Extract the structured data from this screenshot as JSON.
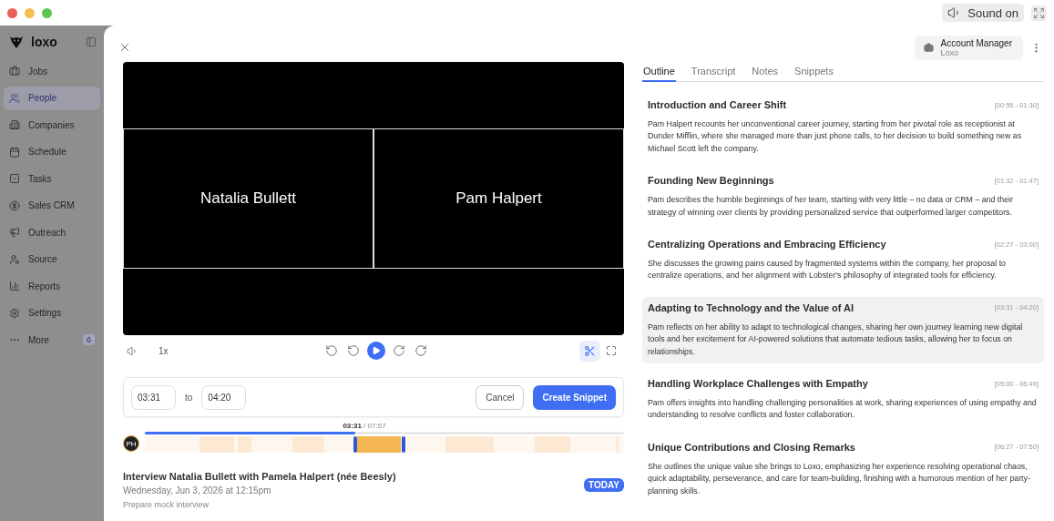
{
  "window": {
    "sound_button": "Sound on"
  },
  "sidebar": {
    "logo": "loxo",
    "items": [
      {
        "label": "Jobs",
        "selected": false
      },
      {
        "label": "People",
        "selected": true
      },
      {
        "label": "Companies",
        "selected": false
      },
      {
        "label": "Schedule",
        "selected": false
      },
      {
        "label": "Tasks",
        "selected": false
      },
      {
        "label": "Sales CRM",
        "selected": false
      },
      {
        "label": "Outreach",
        "selected": false
      },
      {
        "label": "Source",
        "selected": false
      },
      {
        "label": "Reports",
        "selected": false
      },
      {
        "label": "Settings",
        "selected": false
      },
      {
        "label": "More",
        "selected": false,
        "badge": "6"
      }
    ]
  },
  "account": {
    "title": "Account Manager",
    "subtitle": "Loxo"
  },
  "video": {
    "participants": [
      "Natalia Bullett",
      "Pam Halpert"
    ]
  },
  "player": {
    "speed": "1x",
    "clip_mode": true
  },
  "snippet": {
    "start": "03:31",
    "separator": "to",
    "end": "04:20",
    "cancel": "Cancel",
    "create": "Create Snippet"
  },
  "timeline": {
    "current": "03:31",
    "total": "/ 07:57",
    "level": 0.44,
    "avatar": "PH"
  },
  "meeting": {
    "title": "Interview Natalia Bullett with Pamela Halpert (née Beesly)",
    "date": "Wednesday, Jun 3, 2026 at 12:15pm",
    "badge": "TODAY",
    "note": "Prepare mock interview"
  },
  "tabs": [
    {
      "label": "Outline",
      "selected": true
    },
    {
      "label": "Transcript",
      "selected": false
    },
    {
      "label": "Notes",
      "selected": false
    },
    {
      "label": "Snippets",
      "selected": false
    }
  ],
  "outline": [
    {
      "title": "Introduction and Career Shift",
      "time": "[00:55 - 01:30]",
      "summary": "Pam Halpert recounts her unconventional career journey, starting from her pivotal role as receptionist at Dunder Mifflin, where she managed more than just phone calls, to her decision to build something new as Michael Scott left the company.",
      "selected": false
    },
    {
      "title": "Founding New Beginnings",
      "time": "[01:32 - 01:47]",
      "summary": "Pam describes the humble beginnings of her team, starting with very little – no data or CRM – and their strategy of winning over clients by providing personalized service that outperformed larger competitors.",
      "selected": false
    },
    {
      "title": "Centralizing Operations and Embracing Efficiency",
      "time": "[02:27 - 03:00]",
      "summary": "She discusses the growing pains caused by fragmented systems within the company, her proposal to centralize operations, and her alignment with Lobster's philosophy of integrated tools for efficiency.",
      "selected": false
    },
    {
      "title": "Adapting to Technology and the Value of AI",
      "time": "[03:31 - 04:20]",
      "summary": "Pam reflects on her ability to adapt to technological changes, sharing her own journey learning new digital tools and her excitement for AI-powered solutions that automate tedious tasks, allowing her to focus on relationships.",
      "selected": true
    },
    {
      "title": "Handling Workplace Challenges with Empathy",
      "time": "[05:00 - 05:49]",
      "summary": "Pam offers insights into handling challenging personalities at work, sharing experiences of using empathy and understanding to resolve conflicts and foster collaboration.",
      "selected": false
    },
    {
      "title": "Unique Contributions and Closing Remarks",
      "time": "[06:27 - 07:50]",
      "summary": "She outlines the unique value she brings to Loxo, emphasizing her experience resolving operational chaos, quick adaptability, perseverance, and care for team-building, finishing with a humorous mention of her party-planning skills.",
      "selected": false
    }
  ]
}
